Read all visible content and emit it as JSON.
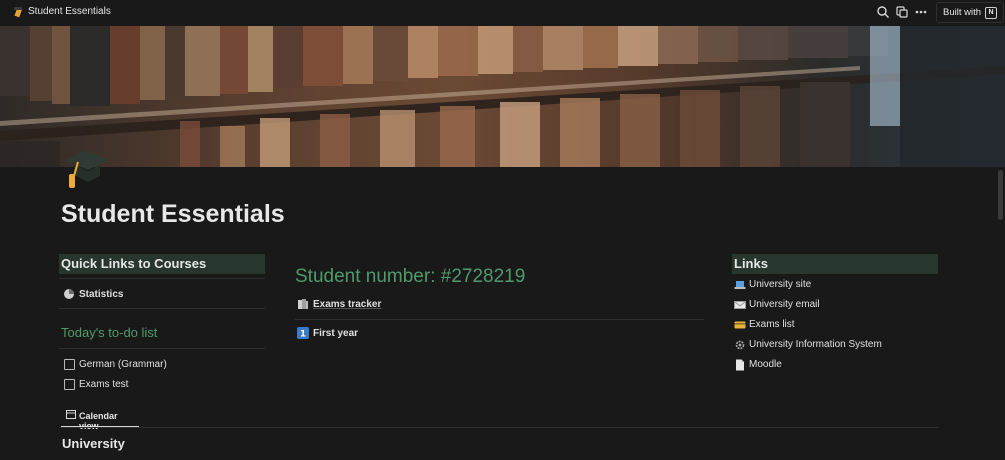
{
  "topbar": {
    "page_title": "Student Essentials",
    "built_with_label": "Built with",
    "icons": [
      "search-icon",
      "duplicate-icon",
      "more-icon"
    ]
  },
  "page": {
    "title": "Student Essentials",
    "icon": "graduation-cap-icon"
  },
  "quick_links": {
    "header": "Quick Links to Courses",
    "items": [
      {
        "label": "Statistics",
        "icon": "pie-chart-icon"
      }
    ]
  },
  "todo": {
    "header": "Today's to-do list",
    "items": [
      {
        "label": "German (Grammar)",
        "checked": false
      },
      {
        "label": "Exams test",
        "checked": false
      }
    ]
  },
  "views": {
    "active_tab": "Calendar view"
  },
  "database": {
    "title": "University"
  },
  "main": {
    "student_number": "Student number: #2728219",
    "items": [
      {
        "label": "Exams tracker",
        "icon": "books-icon"
      },
      {
        "label": "First year",
        "icon": "number-one-icon"
      }
    ]
  },
  "links": {
    "header": "Links",
    "items": [
      {
        "label": "University site",
        "icon": "laptop-icon"
      },
      {
        "label": "University email",
        "icon": "envelope-icon"
      },
      {
        "label": "Exams list",
        "icon": "credit-card-icon"
      },
      {
        "label": "University Information System",
        "icon": "gear-icon"
      },
      {
        "label": "Moodle",
        "icon": "page-icon"
      }
    ]
  },
  "colors": {
    "background": "#191919",
    "header_block": "#27372d",
    "accent_green": "#4f9a6b"
  }
}
